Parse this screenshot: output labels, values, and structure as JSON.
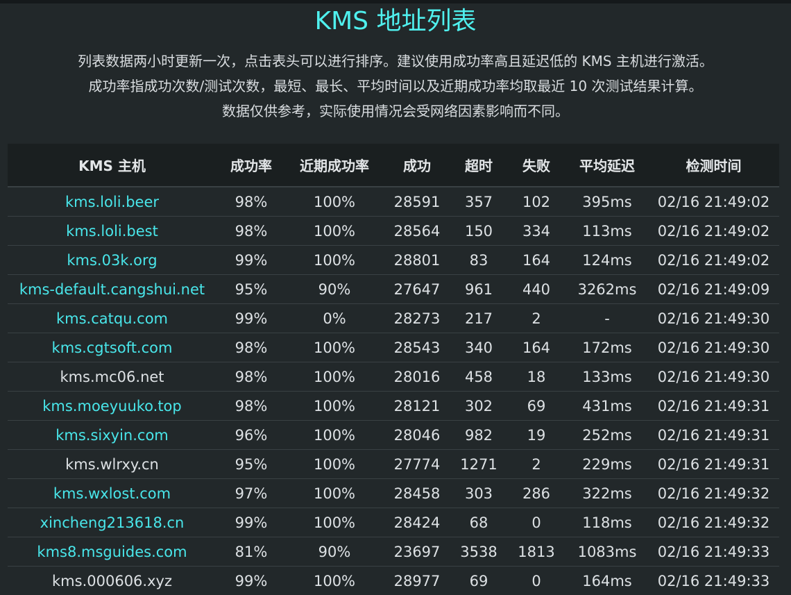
{
  "page": {
    "title": "KMS 地址列表",
    "intro": [
      "列表数据两小时更新一次，点击表头可以进行排序。建议使用成功率高且延迟低的 KMS 主机进行激活。",
      "成功率指成功次数/测试次数，最短、最长、平均时间以及近期成功率均取最近 10 次测试结果计算。",
      "数据仅供参考，实际使用情况会受网络因素影响而不同。"
    ],
    "accent_color": "#4ff0ee",
    "link_color": "#49e6ea"
  },
  "table": {
    "headers": [
      "KMS 主机",
      "成功率",
      "近期成功率",
      "成功",
      "超时",
      "失败",
      "平均延迟",
      "检测时间"
    ],
    "rows": [
      {
        "host": "kms.loli.beer",
        "rate": "98%",
        "recent": "100%",
        "success": "28591",
        "timeout": "357",
        "fail": "102",
        "latency": "395ms",
        "time": "02/16 21:49:02",
        "link": true
      },
      {
        "host": "kms.loli.best",
        "rate": "98%",
        "recent": "100%",
        "success": "28564",
        "timeout": "150",
        "fail": "334",
        "latency": "113ms",
        "time": "02/16 21:49:02",
        "link": true
      },
      {
        "host": "kms.03k.org",
        "rate": "99%",
        "recent": "100%",
        "success": "28801",
        "timeout": "83",
        "fail": "164",
        "latency": "124ms",
        "time": "02/16 21:49:02",
        "link": true
      },
      {
        "host": "kms-default.cangshui.net",
        "rate": "95%",
        "recent": "90%",
        "success": "27647",
        "timeout": "961",
        "fail": "440",
        "latency": "3262ms",
        "time": "02/16 21:49:09",
        "link": true
      },
      {
        "host": "kms.catqu.com",
        "rate": "99%",
        "recent": "0%",
        "success": "28273",
        "timeout": "217",
        "fail": "2",
        "latency": "-",
        "time": "02/16 21:49:30",
        "link": true
      },
      {
        "host": "kms.cgtsoft.com",
        "rate": "98%",
        "recent": "100%",
        "success": "28543",
        "timeout": "340",
        "fail": "164",
        "latency": "172ms",
        "time": "02/16 21:49:30",
        "link": true
      },
      {
        "host": "kms.mc06.net",
        "rate": "98%",
        "recent": "100%",
        "success": "28016",
        "timeout": "458",
        "fail": "18",
        "latency": "133ms",
        "time": "02/16 21:49:30",
        "link": false
      },
      {
        "host": "kms.moeyuuko.top",
        "rate": "98%",
        "recent": "100%",
        "success": "28121",
        "timeout": "302",
        "fail": "69",
        "latency": "431ms",
        "time": "02/16 21:49:31",
        "link": true
      },
      {
        "host": "kms.sixyin.com",
        "rate": "96%",
        "recent": "100%",
        "success": "28046",
        "timeout": "982",
        "fail": "19",
        "latency": "252ms",
        "time": "02/16 21:49:31",
        "link": true
      },
      {
        "host": "kms.wlrxy.cn",
        "rate": "95%",
        "recent": "100%",
        "success": "27774",
        "timeout": "1271",
        "fail": "2",
        "latency": "229ms",
        "time": "02/16 21:49:31",
        "link": false
      },
      {
        "host": "kms.wxlost.com",
        "rate": "97%",
        "recent": "100%",
        "success": "28458",
        "timeout": "303",
        "fail": "286",
        "latency": "322ms",
        "time": "02/16 21:49:32",
        "link": true
      },
      {
        "host": "xincheng213618.cn",
        "rate": "99%",
        "recent": "100%",
        "success": "28424",
        "timeout": "68",
        "fail": "0",
        "latency": "118ms",
        "time": "02/16 21:49:32",
        "link": true
      },
      {
        "host": "kms8.msguides.com",
        "rate": "81%",
        "recent": "90%",
        "success": "23697",
        "timeout": "3538",
        "fail": "1813",
        "latency": "1083ms",
        "time": "02/16 21:49:33",
        "link": true
      },
      {
        "host": "kms.000606.xyz",
        "rate": "99%",
        "recent": "100%",
        "success": "28977",
        "timeout": "69",
        "fail": "0",
        "latency": "164ms",
        "time": "02/16 21:49:33",
        "link": false
      }
    ]
  }
}
